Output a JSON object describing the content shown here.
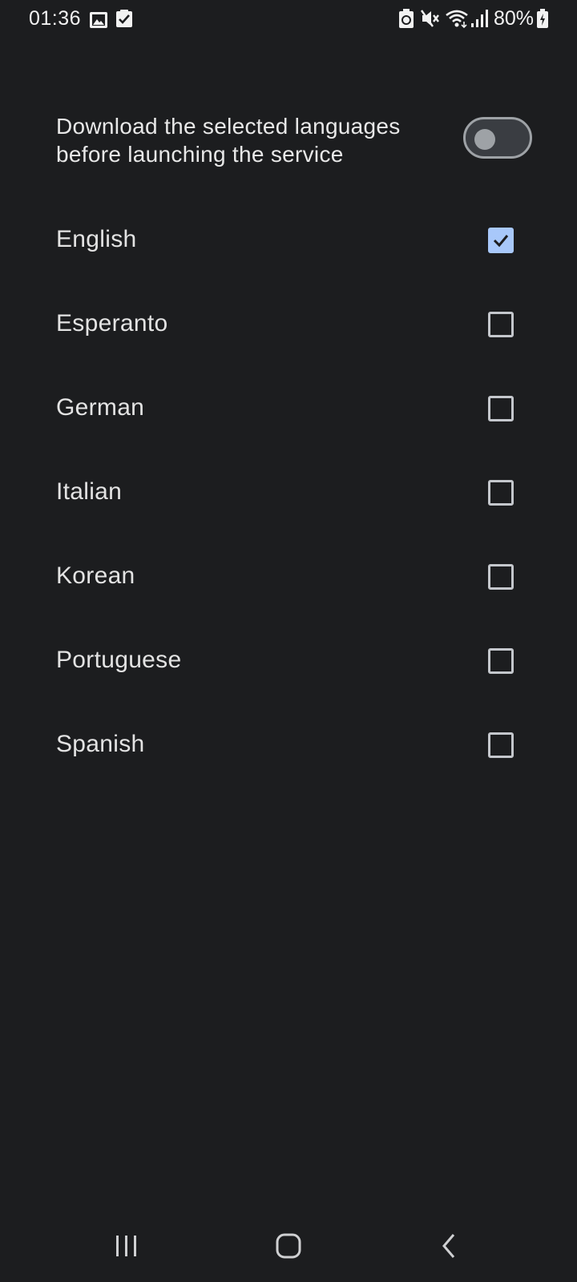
{
  "status_bar": {
    "time": "01:36",
    "battery_percent": "80%",
    "icons": [
      "gallery-icon",
      "check-notification-icon",
      "battery-saver-icon",
      "mute-icon",
      "wifi-icon",
      "signal-icon",
      "battery-charging-icon"
    ]
  },
  "settings": {
    "download_toggle": {
      "label": "Download the selected languages before launching the service",
      "enabled": false
    }
  },
  "languages": [
    {
      "label": "English",
      "checked": true
    },
    {
      "label": "Esperanto",
      "checked": false
    },
    {
      "label": "German",
      "checked": false
    },
    {
      "label": "Italian",
      "checked": false
    },
    {
      "label": "Korean",
      "checked": false
    },
    {
      "label": "Portuguese",
      "checked": false
    },
    {
      "label": "Spanish",
      "checked": false
    }
  ],
  "nav_bar": {
    "buttons": [
      "recents-icon",
      "home-icon",
      "back-icon"
    ]
  },
  "colors": {
    "background": "#1c1d1f",
    "accent": "#a8c8fa",
    "text": "#e3e3e3"
  }
}
